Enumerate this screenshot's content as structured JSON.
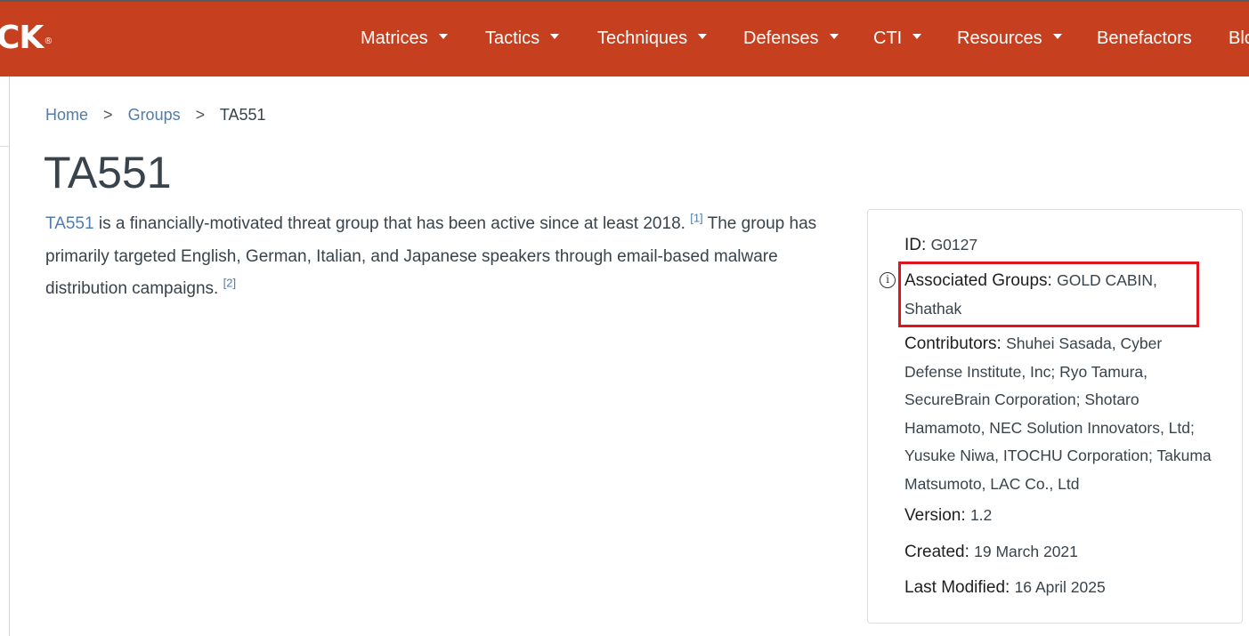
{
  "nav": {
    "brand": "CK",
    "brand_mark": "®",
    "items": [
      {
        "label": "Matrices",
        "dropdown": true
      },
      {
        "label": "Tactics",
        "dropdown": true
      },
      {
        "label": "Techniques",
        "dropdown": true
      },
      {
        "label": "Defenses",
        "dropdown": true
      },
      {
        "label": "CTI",
        "dropdown": true
      },
      {
        "label": "Resources",
        "dropdown": true
      },
      {
        "label": "Benefactors",
        "dropdown": false
      },
      {
        "label": "Blo",
        "dropdown": false
      }
    ]
  },
  "breadcrumb": {
    "home": "Home",
    "groups": "Groups",
    "current": "TA551",
    "separator": ">"
  },
  "page": {
    "title": "TA551",
    "description": {
      "link_text": "TA551",
      "text1": " is a financially-motivated threat group that has been active since at least 2018. ",
      "ref1": "[1]",
      "text2": " The group has primarily targeted English, German, Italian, and Japanese speakers through email-based malware distribution campaigns. ",
      "ref2": "[2]"
    }
  },
  "card": {
    "id_label": "ID:",
    "id_value": "G0127",
    "assoc_label": "Associated Groups:",
    "assoc_value": "GOLD CABIN, Shathak",
    "contrib_label": "Contributors:",
    "contrib_value": "Shuhei Sasada, Cyber Defense Institute, Inc; Ryo Tamura, SecureBrain Corporation; Shotaro Hamamoto, NEC Solution Innovators, Ltd; Yusuke Niwa, ITOCHU Corporation; Takuma Matsumoto, LAC Co., Ltd",
    "version_label": "Version:",
    "version_value": "1.2",
    "created_label": "Created:",
    "created_value": "19 March 2021",
    "modified_label": "Last Modified:",
    "modified_value": "16 April 2025",
    "info_icon_glyph": "i"
  },
  "colors": {
    "navbar": "#c63f1f",
    "link": "#4f7cac",
    "highlight": "#e0141f"
  }
}
